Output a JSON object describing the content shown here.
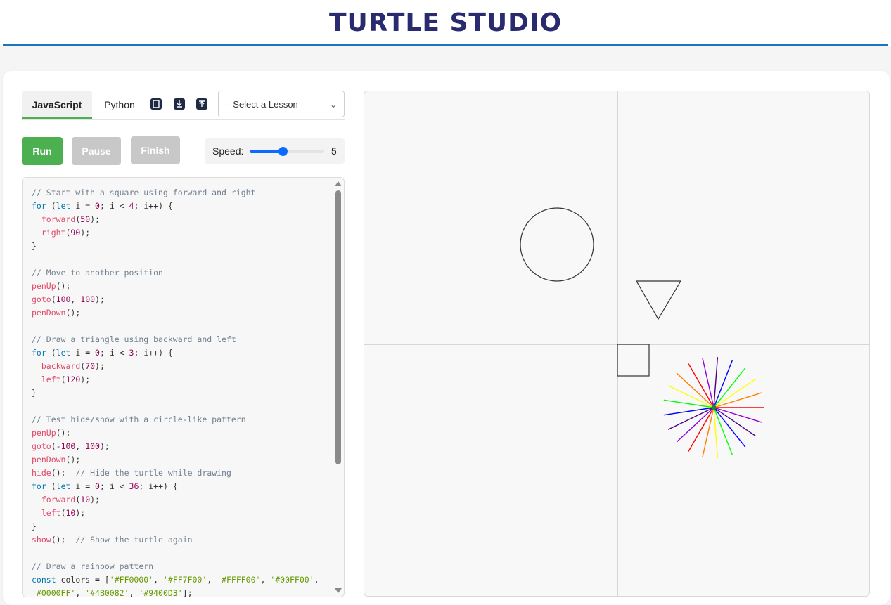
{
  "app": {
    "title": "TURTLE STUDIO",
    "title_color": "#2a2a6e",
    "rule_color": "#1e73be"
  },
  "tabs": {
    "javascript": "JavaScript",
    "python": "Python"
  },
  "toolbar": {
    "icons": [
      "copy-icon",
      "download-icon",
      "upload-icon"
    ]
  },
  "lesson_select": {
    "selected": "-- Select a Lesson --"
  },
  "controls": {
    "run": "Run",
    "pause": "Pause",
    "finish": "Finish",
    "run_color": "#4caf50",
    "disabled_color": "#c8c8c8"
  },
  "speed": {
    "label": "Speed:",
    "value": "5",
    "min": 1,
    "max": 10
  },
  "editor": {
    "lines": [
      "// Start with a square using forward and right",
      "for (let i = 0; i < 4; i++) {",
      "  forward(50);",
      "  right(90);",
      "}",
      "",
      "// Move to another position",
      "penUp();",
      "goto(100, 100);",
      "penDown();",
      "",
      "// Draw a triangle using backward and left",
      "for (let i = 0; i < 3; i++) {",
      "  backward(70);",
      "  left(120);",
      "}",
      "",
      "// Test hide/show with a circle-like pattern",
      "penUp();",
      "goto(-100, 100);",
      "penDown();",
      "hide();  // Hide the turtle while drawing",
      "for (let i = 0; i < 36; i++) {",
      "  forward(10);",
      "  left(10);",
      "}",
      "show();  // Show the turtle again",
      "",
      "// Draw a rainbow pattern",
      "const colors = ['#FF0000', '#FF7F00', '#FFFF00', '#00FF00',",
      "'#0000FF', '#4B0082', '#9400D3'];"
    ]
  },
  "canvas": {
    "axis_color": "#cccccc",
    "rainbow": [
      "#FF0000",
      "#FF7F00",
      "#FFFF00",
      "#00FF00",
      "#0000FF",
      "#4B0082",
      "#9400D3"
    ]
  }
}
